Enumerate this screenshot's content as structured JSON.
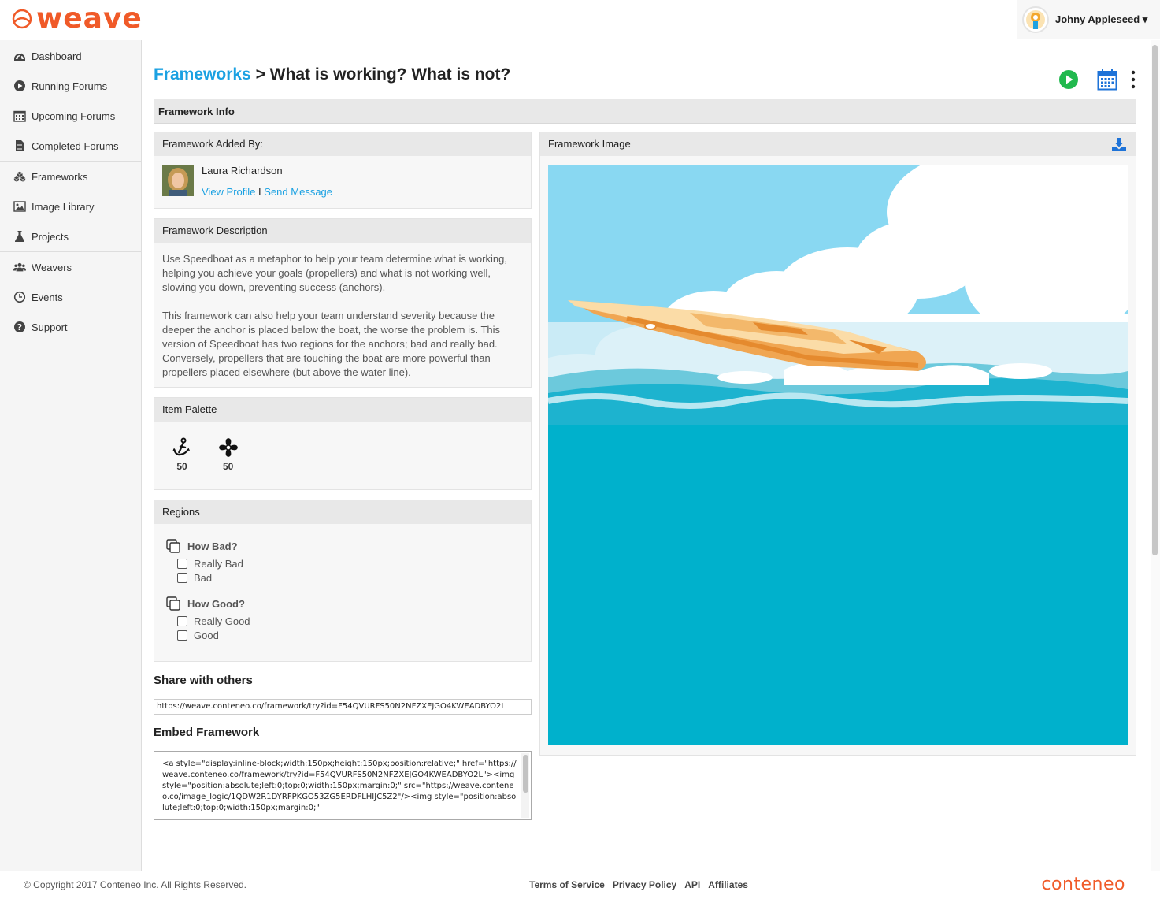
{
  "app": {
    "logo_text": "weave",
    "brand_color": "#f05a28",
    "accent_color": "#1ba1e2"
  },
  "user": {
    "name": "Johny Appleseed ▾"
  },
  "sidebar": {
    "items": [
      {
        "label": "Dashboard",
        "icon": "dashboard-icon"
      },
      {
        "label": "Running Forums",
        "icon": "play-circle-icon"
      },
      {
        "label": "Upcoming Forums",
        "icon": "calendar-icon"
      },
      {
        "label": "Completed Forums",
        "icon": "document-icon"
      },
      {
        "label": "Frameworks",
        "icon": "cubes-icon"
      },
      {
        "label": "Image Library",
        "icon": "image-icon"
      },
      {
        "label": "Projects",
        "icon": "flask-icon"
      },
      {
        "label": "Weavers",
        "icon": "users-icon"
      },
      {
        "label": "Events",
        "icon": "clock-icon"
      },
      {
        "label": "Support",
        "icon": "question-icon"
      }
    ]
  },
  "header": {
    "breadcrumb_link": "Frameworks",
    "separator": " > ",
    "title": "What is working? What is not?"
  },
  "section_title": "Framework Info",
  "added_by": {
    "heading": "Framework Added By:",
    "name": "Laura Richardson",
    "view_profile": "View Profile",
    "divider": "I",
    "send_message": "Send Message"
  },
  "description": {
    "heading": "Framework Description",
    "paragraph1": "Use Speedboat as a metaphor to help your team determine what is working, helping you achieve your goals (propellers) and what is not working well, slowing you down, preventing success (anchors).",
    "paragraph2": "This framework can also help your team understand severity because the deeper the anchor is placed below the boat, the worse the problem is. This version of Speedboat has two regions for the anchors; bad and really bad. Conversely, propellers that are touching the boat are more powerful than propellers placed elsewhere (but above the water line)."
  },
  "palette": {
    "heading": "Item Palette",
    "items": [
      {
        "icon": "anchor-icon",
        "count": "50"
      },
      {
        "icon": "propeller-icon",
        "count": "50"
      }
    ]
  },
  "regions": {
    "heading": "Regions",
    "groups": [
      {
        "label": "How Bad?",
        "options": [
          "Really Bad",
          "Bad"
        ]
      },
      {
        "label": "How Good?",
        "options": [
          "Really Good",
          "Good"
        ]
      }
    ]
  },
  "share": {
    "heading": "Share with others",
    "url": "https://weave.conteneo.co/framework/try?id=F54QVURFS50N2NFZXEJGO4KWEADBYO2L"
  },
  "embed": {
    "heading": "Embed Framework",
    "code": "<a style=\"display:inline-block;width:150px;height:150px;position:relative;\" href=\"https://weave.conteneo.co/framework/try?id=F54QVURFS50N2NFZXEJGO4KWEADBYO2L\"><img style=\"position:absolute;left:0;top:0;width:150px;margin:0;\" src=\"https://weave.conteneo.co/image_logic/1QDW2R1DYRFPKGO53ZG5ERDFLHIJC5Z2\"/><img style=\"position:absolute;left:0;top:0;width:150px;margin:0;\""
  },
  "image_panel": {
    "heading": "Framework Image"
  },
  "footer": {
    "copyright": "© Copyright 2017 Conteneo Inc. All Rights Reserved.",
    "links": [
      "Terms of Service",
      "Privacy Policy",
      "API",
      "Affiliates"
    ],
    "brand": "conteneo"
  }
}
